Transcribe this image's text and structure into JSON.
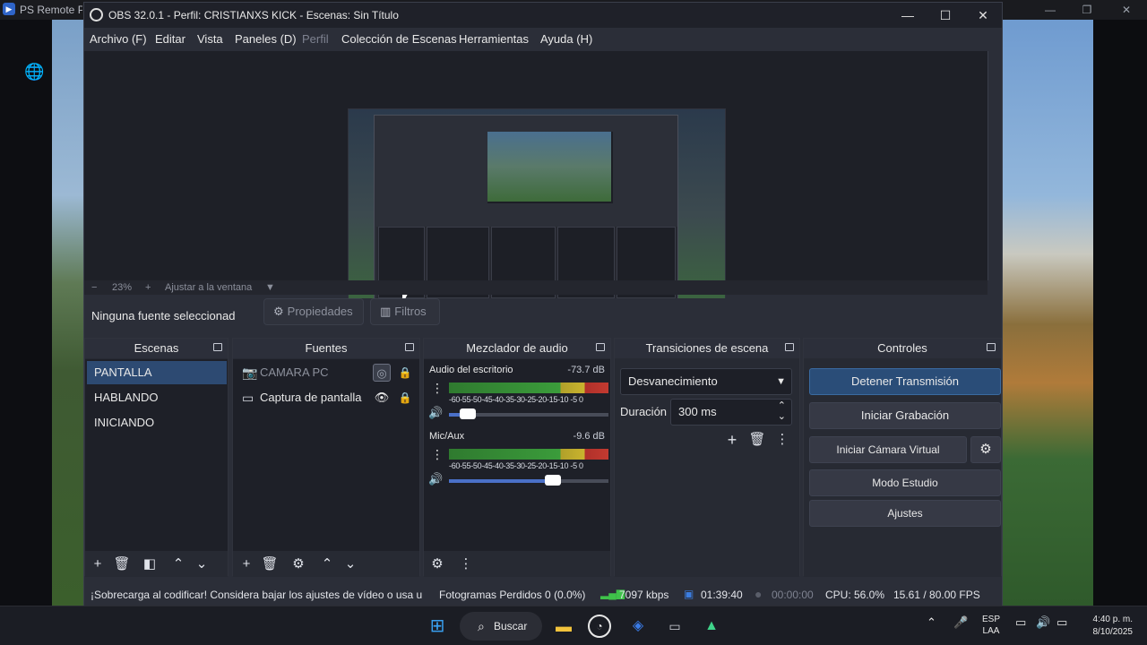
{
  "remote_play": {
    "title": "PS Remote Pla",
    "logo_icon": "ps-remote-play-icon",
    "net_icon": "network-warning-icon"
  },
  "obs": {
    "title": "OBS 32.0.1 - Perfil: CRISTIANXS KICK - Escenas: Sin Título",
    "menu": [
      "Archivo (F)",
      "Editar",
      "Vista",
      "Paneles (D)",
      "Perfil",
      "Colección de Escenas",
      "Herramientas",
      "Ayuda (H)"
    ],
    "zoom": {
      "minus": "−",
      "value": "23%",
      "plus": "+",
      "fit": "Ajustar a la ventana",
      "dropdown": "▼"
    },
    "source_toolbar": {
      "none_selected": "Ninguna fuente seleccionad",
      "properties": "Propiedades",
      "filters": "Filtros"
    },
    "docks": {
      "scenes": {
        "title": "Escenas",
        "items": [
          "PANTALLA",
          "HABLANDO",
          "INICIANDO"
        ],
        "selected": "PANTALLA"
      },
      "sources": {
        "title": "Fuentes",
        "items": [
          {
            "label": "CAMARA PC",
            "icon": "camera-icon",
            "visible": false,
            "locked": true
          },
          {
            "label": "Captura de pantalla",
            "icon": "monitor-icon",
            "visible": true,
            "locked": true
          }
        ]
      },
      "mixer": {
        "title": "Mezclador de audio",
        "channels": [
          {
            "name": "Audio del escritorio",
            "db": "-73.7 dB",
            "scale": "-60-55-50-45-40-35-30-25-20-15-10 -5 0",
            "volume": 0.12
          },
          {
            "name": "Mic/Aux",
            "db": "-9.6 dB",
            "scale": "-60-55-50-45-40-35-30-25-20-15-10 -5 0",
            "volume": 0.65
          }
        ]
      },
      "transitions": {
        "title": "Transiciones de escena",
        "transition": "Desvanecimiento",
        "duration_label": "Duración",
        "duration_value": "300 ms"
      },
      "controls": {
        "title": "Controles",
        "stop_stream": "Detener Transmisión",
        "start_recording": "Iniciar Grabación",
        "start_virtual_cam": "Iniciar Cámara Virtual",
        "studio_mode": "Modo Estudio",
        "settings": "Ajustes"
      }
    },
    "status": {
      "warning": "¡Sobrecarga al codificar! Considera bajar los ajustes de vídeo o usa u",
      "dropped_frames": "Fotogramas Perdidos 0 (0.0%)",
      "bitrate": "7097 kbps",
      "stream_time": "01:39:40",
      "rec_time": "00:00:00",
      "cpu": "CPU: 56.0%",
      "fps": "15.61 / 80.00 FPS"
    }
  },
  "taskbar": {
    "search": "Buscar",
    "lang_top": "ESP",
    "lang_bottom": "LAA",
    "time": "4:40 p. m.",
    "date": "8/10/2025"
  }
}
